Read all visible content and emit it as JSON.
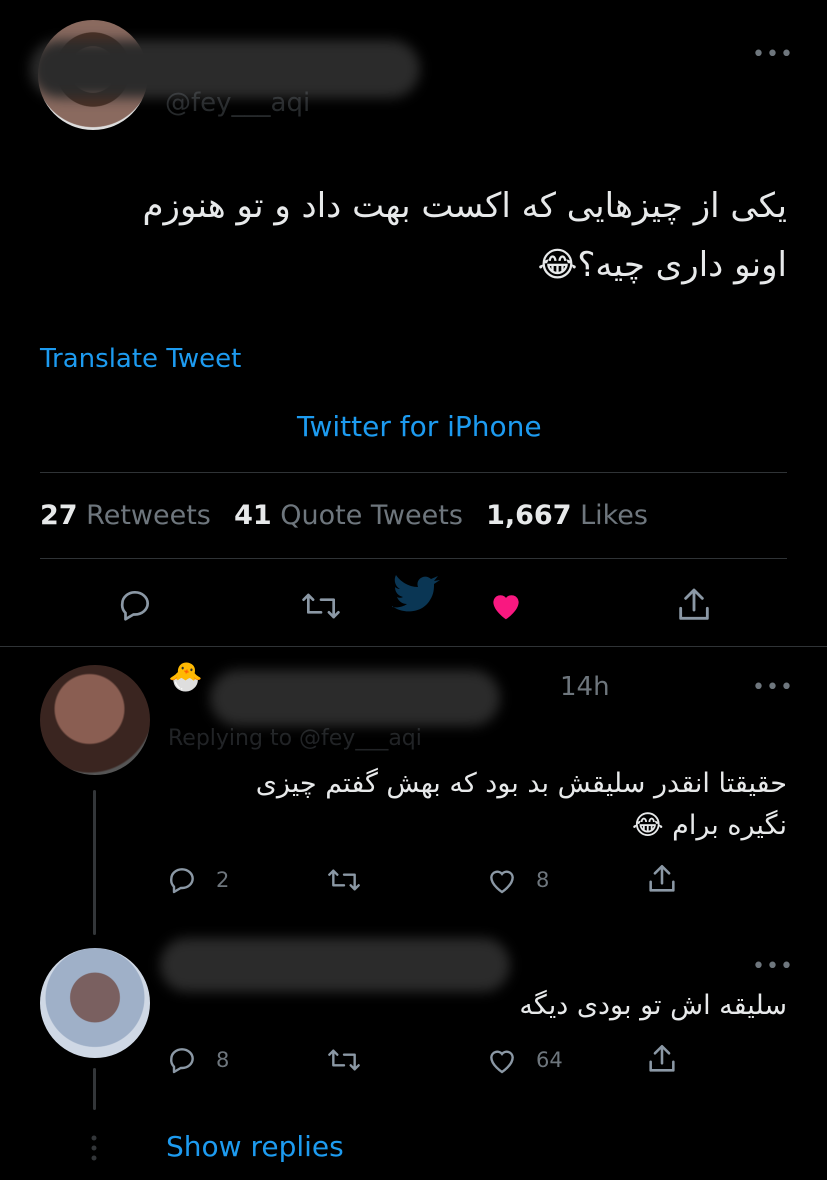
{
  "main_tweet": {
    "handle_partial": "@fey___aqi",
    "text_line1": "یکی از چیزهایی که اکست بهت داد و تو هنوزم",
    "text_line2": "اونو داری چیه؟😂",
    "translate_label": "Translate Tweet",
    "source": "Twitter for iPhone",
    "stats": {
      "retweets_count": "27",
      "retweets_label": "Retweets",
      "quotes_count": "41",
      "quotes_label": "Quote Tweets",
      "likes_count": "1,667",
      "likes_label": "Likes"
    },
    "more_icon": "•••"
  },
  "reply1": {
    "time": "14h",
    "replying_to": "Replying to @fey___aqi",
    "text_line1": "حقیقتا انقدر سلیقش بد بود که بهش گفتم چیزی",
    "text_line2": "نگیره برام 😂",
    "reply_count": "2",
    "like_count": "8",
    "more_icon": "•••"
  },
  "reply2": {
    "text": "سلیقه اش تو بودی دیگه",
    "reply_count": "8",
    "like_count": "64",
    "more_icon": "•••"
  },
  "show_replies_label": "Show replies",
  "colors": {
    "accent": "#1d9bf0",
    "like_active": "#f91880",
    "muted": "#6e767d",
    "divider": "#2f3336"
  },
  "icons": [
    "reply-icon",
    "retweet-icon",
    "like-icon",
    "share-icon",
    "more-icon"
  ]
}
